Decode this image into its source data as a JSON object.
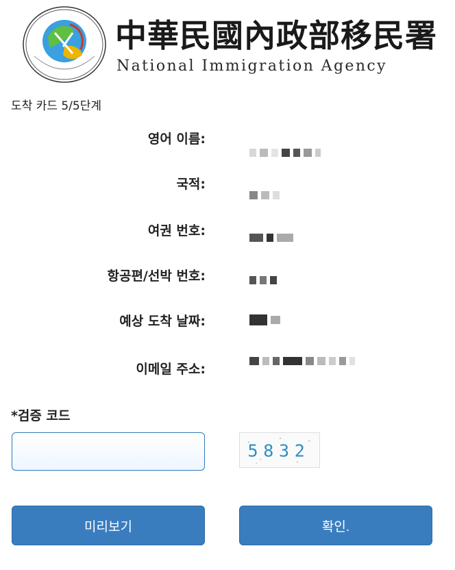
{
  "header": {
    "agency_name_zh": "中華民國內政部移民署",
    "agency_name_en": "National Immigration Agency",
    "logo_icon": "national-immigration-agency-logo",
    "logo_text": "National Immigration Agency"
  },
  "step_text": "도착 카드 5/5단계",
  "fields": [
    {
      "label": "영어 이름:"
    },
    {
      "label": "국적:"
    },
    {
      "label": "여권 번호:"
    },
    {
      "label": "항공편/선박 번호:"
    },
    {
      "label": "예상 도착 날짜:"
    },
    {
      "label": "이메일 주소:"
    }
  ],
  "captcha": {
    "label": "*검증 코드",
    "input_value": "",
    "image_code": "5832",
    "code_color": "#2f8fc4"
  },
  "buttons": {
    "preview": "미리보기",
    "confirm": "확인."
  },
  "colors": {
    "button_bg": "#3a7dbf",
    "input_border": "#2f78b9"
  }
}
